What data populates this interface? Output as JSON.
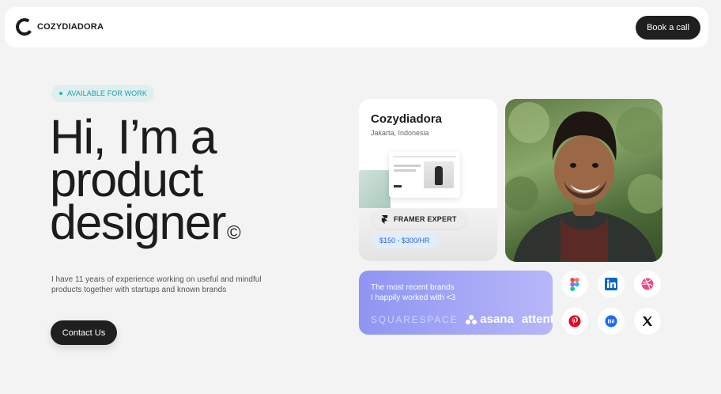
{
  "header": {
    "brand": "COZYDIADORA",
    "cta_label": "Book a call"
  },
  "hero": {
    "badge": "AVAILABLE FOR WORK",
    "headline_lines": [
      "Hi, I’m a",
      "product",
      "designer"
    ],
    "copyright_symbol": "©",
    "intro": "I have 11 years of experience working on useful and mindful products together with startups and known brands",
    "contact_label": "Contact Us"
  },
  "profile": {
    "name": "Cozydiadora",
    "location": "Jakarta, Indonesia",
    "tag": "FRAMER EXPERT",
    "rate": "$150 - $300/HR"
  },
  "brands": {
    "text_line1": "The most recent brands",
    "text_line2": "I happily worked with <3",
    "logos": [
      "SQUARESPACE",
      "asana",
      "attent"
    ]
  },
  "socials": [
    {
      "name": "figma-icon",
      "color": "#f24e1e"
    },
    {
      "name": "linkedin-icon",
      "color": "#0a66c2"
    },
    {
      "name": "dribbble-icon",
      "color": "#ea4c89"
    },
    {
      "name": "pinterest-icon",
      "color": "#e60023"
    },
    {
      "name": "behance-icon",
      "color": "#1769ff"
    },
    {
      "name": "x-icon",
      "color": "#111111"
    }
  ],
  "colors": {
    "accent_teal": "#17a4a8",
    "dark_button": "#1f1f1f",
    "rate_blue": "#2b66d8"
  }
}
